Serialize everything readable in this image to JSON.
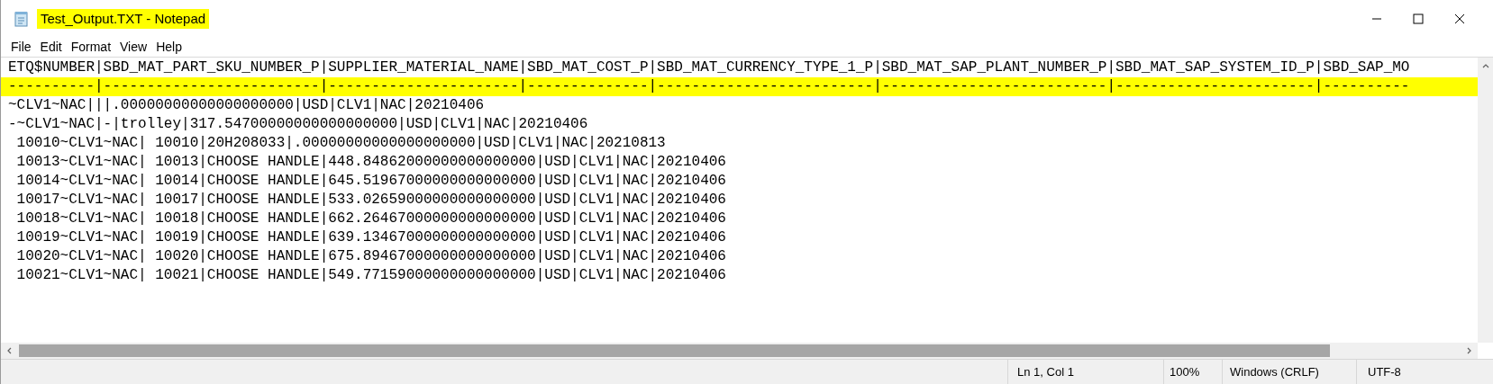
{
  "window": {
    "title": "Test_Output.TXT - Notepad",
    "title_highlighted": true
  },
  "menu": [
    "File",
    "Edit",
    "Format",
    "View",
    "Help"
  ],
  "editor": {
    "lines": [
      {
        "text": "ETQ$NUMBER|SBD_MAT_PART_SKU_NUMBER_P|SUPPLIER_MATERIAL_NAME|SBD_MAT_COST_P|SBD_MAT_CURRENCY_TYPE_1_P|SBD_MAT_SAP_PLANT_NUMBER_P|SBD_MAT_SAP_SYSTEM_ID_P|SBD_SAP_MO",
        "highlighted": false
      },
      {
        "text": "----------|-------------------------|----------------------|--------------|-------------------------|--------------------------|-----------------------|----------",
        "highlighted": true
      },
      {
        "text": "~CLV1~NAC|||.00000000000000000000|USD|CLV1|NAC|20210406",
        "highlighted": false
      },
      {
        "text": "-~CLV1~NAC|-|trolley|317.54700000000000000000|USD|CLV1|NAC|20210406",
        "highlighted": false
      },
      {
        "text": " 10010~CLV1~NAC| 10010|20H208033|.00000000000000000000|USD|CLV1|NAC|20210813",
        "highlighted": false
      },
      {
        "text": " 10013~CLV1~NAC| 10013|CHOOSE HANDLE|448.84862000000000000000|USD|CLV1|NAC|20210406",
        "highlighted": false
      },
      {
        "text": " 10014~CLV1~NAC| 10014|CHOOSE HANDLE|645.51967000000000000000|USD|CLV1|NAC|20210406",
        "highlighted": false
      },
      {
        "text": " 10017~CLV1~NAC| 10017|CHOOSE HANDLE|533.02659000000000000000|USD|CLV1|NAC|20210406",
        "highlighted": false
      },
      {
        "text": " 10018~CLV1~NAC| 10018|CHOOSE HANDLE|662.26467000000000000000|USD|CLV1|NAC|20210406",
        "highlighted": false
      },
      {
        "text": " 10019~CLV1~NAC| 10019|CHOOSE HANDLE|639.13467000000000000000|USD|CLV1|NAC|20210406",
        "highlighted": false
      },
      {
        "text": " 10020~CLV1~NAC| 10020|CHOOSE HANDLE|675.89467000000000000000|USD|CLV1|NAC|20210406",
        "highlighted": false
      },
      {
        "text": " 10021~CLV1~NAC| 10021|CHOOSE HANDLE|549.77159000000000000000|USD|CLV1|NAC|20210406",
        "highlighted": false
      }
    ]
  },
  "status_bar": {
    "position": "Ln 1, Col 1",
    "zoom": "100%",
    "line_endings": "Windows (CRLF)",
    "encoding": "UTF-8"
  }
}
